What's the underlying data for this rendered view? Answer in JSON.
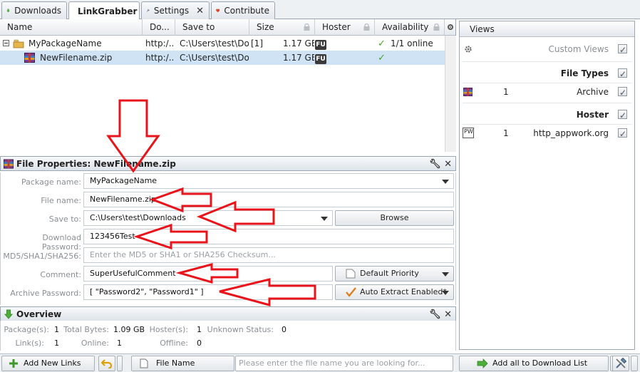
{
  "tabs": [
    {
      "label": "Downloads",
      "icon": "download-arrow-icon"
    },
    {
      "label": "LinkGrabber",
      "icon": "magnifier-icon"
    },
    {
      "label": "Settings",
      "icon": "wrench-icon"
    },
    {
      "label": "Contribute",
      "icon": "heart-icon"
    }
  ],
  "table": {
    "columns": [
      "Name",
      "Do...",
      "Save to",
      "Size",
      "Hoster",
      "Availability"
    ],
    "rows": [
      {
        "name": "MyPackageName",
        "url": "http:/...",
        "save_to": "C:\\Users\\test\\Do...",
        "count": "[1]",
        "size": "1.17 GB",
        "hoster_badge": "FU",
        "availability": "1/1 online",
        "type": "package"
      },
      {
        "name": "NewFilename.zip",
        "url": "http:/...",
        "save_to": "C:\\Users\\test\\Do...",
        "count": "",
        "size": "1.17 GB",
        "hoster_badge": "FU",
        "availability": "",
        "type": "file"
      }
    ]
  },
  "views": {
    "title": "Views",
    "custom_views": "Custom Views",
    "file_types_header": "File Types",
    "file_types": [
      {
        "count": "1",
        "label": "Archive"
      }
    ],
    "hoster_header": "Hoster",
    "hosters": [
      {
        "badge": "PW",
        "count": "1",
        "label": "http_appwork.org"
      }
    ]
  },
  "file_properties": {
    "title": "File Properties: NewFilename.zip",
    "labels": {
      "package_name": "Package name:",
      "file_name": "File name:",
      "save_to": "Save to:",
      "download_password": "Download Password:",
      "checksum": "MD5/SHA1/SHA256:",
      "comment": "Comment:",
      "archive_password": "Archive Password:"
    },
    "values": {
      "package_name": "MyPackageName",
      "file_name": "NewFilename.zip",
      "save_to": "C:\\Users\\test\\Downloads",
      "download_password": "123456Test",
      "checksum_placeholder": "Enter the MD5 or SHA1 or SHA256 Checksum...",
      "comment": "SuperUsefulComment",
      "archive_password": "[ \"Password2\", \"Password1\" ]"
    },
    "browse_label": "Browse",
    "priority_label": "Default Priority",
    "extract_label": "Auto Extract Enabled*"
  },
  "overview": {
    "title": "Overview",
    "packages_label": "Package(s):",
    "packages": "1",
    "total_bytes_label": "Total Bytes:",
    "total_bytes": "1.09 GB",
    "hosters_label": "Hoster(s):",
    "hosters": "1",
    "unknown_label": "Unknown Status:",
    "unknown": "0",
    "links_label": "Link(s):",
    "links": "1",
    "online_label": "Online:",
    "online": "1",
    "offline_label": "Offline:",
    "offline": "0"
  },
  "bottom": {
    "add_links": "Add New Links",
    "sort_label": "File Name",
    "search_placeholder": "Please enter the file name you are looking for...",
    "add_all": "Add all to Download List"
  },
  "colors": {
    "accent": "#cfe3f5",
    "annotation": "#e8141b",
    "check": "#4aa326"
  }
}
